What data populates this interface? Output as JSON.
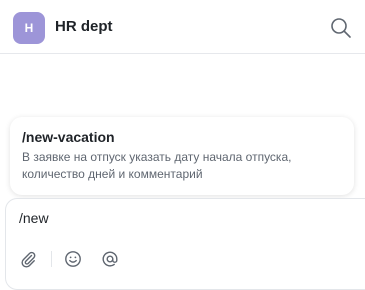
{
  "header": {
    "avatar_letter": "H",
    "avatar_color": "#9d95d8",
    "title": "HR dept",
    "search_icon": "search-icon"
  },
  "suggestion": {
    "command": "/new-vacation",
    "description": "В заявке на отпуск указать дату начала отпуска, количество дней и комментарий"
  },
  "composer": {
    "value": "/new",
    "tools": [
      "paperclip-icon",
      "smile-icon",
      "at-icon"
    ]
  }
}
